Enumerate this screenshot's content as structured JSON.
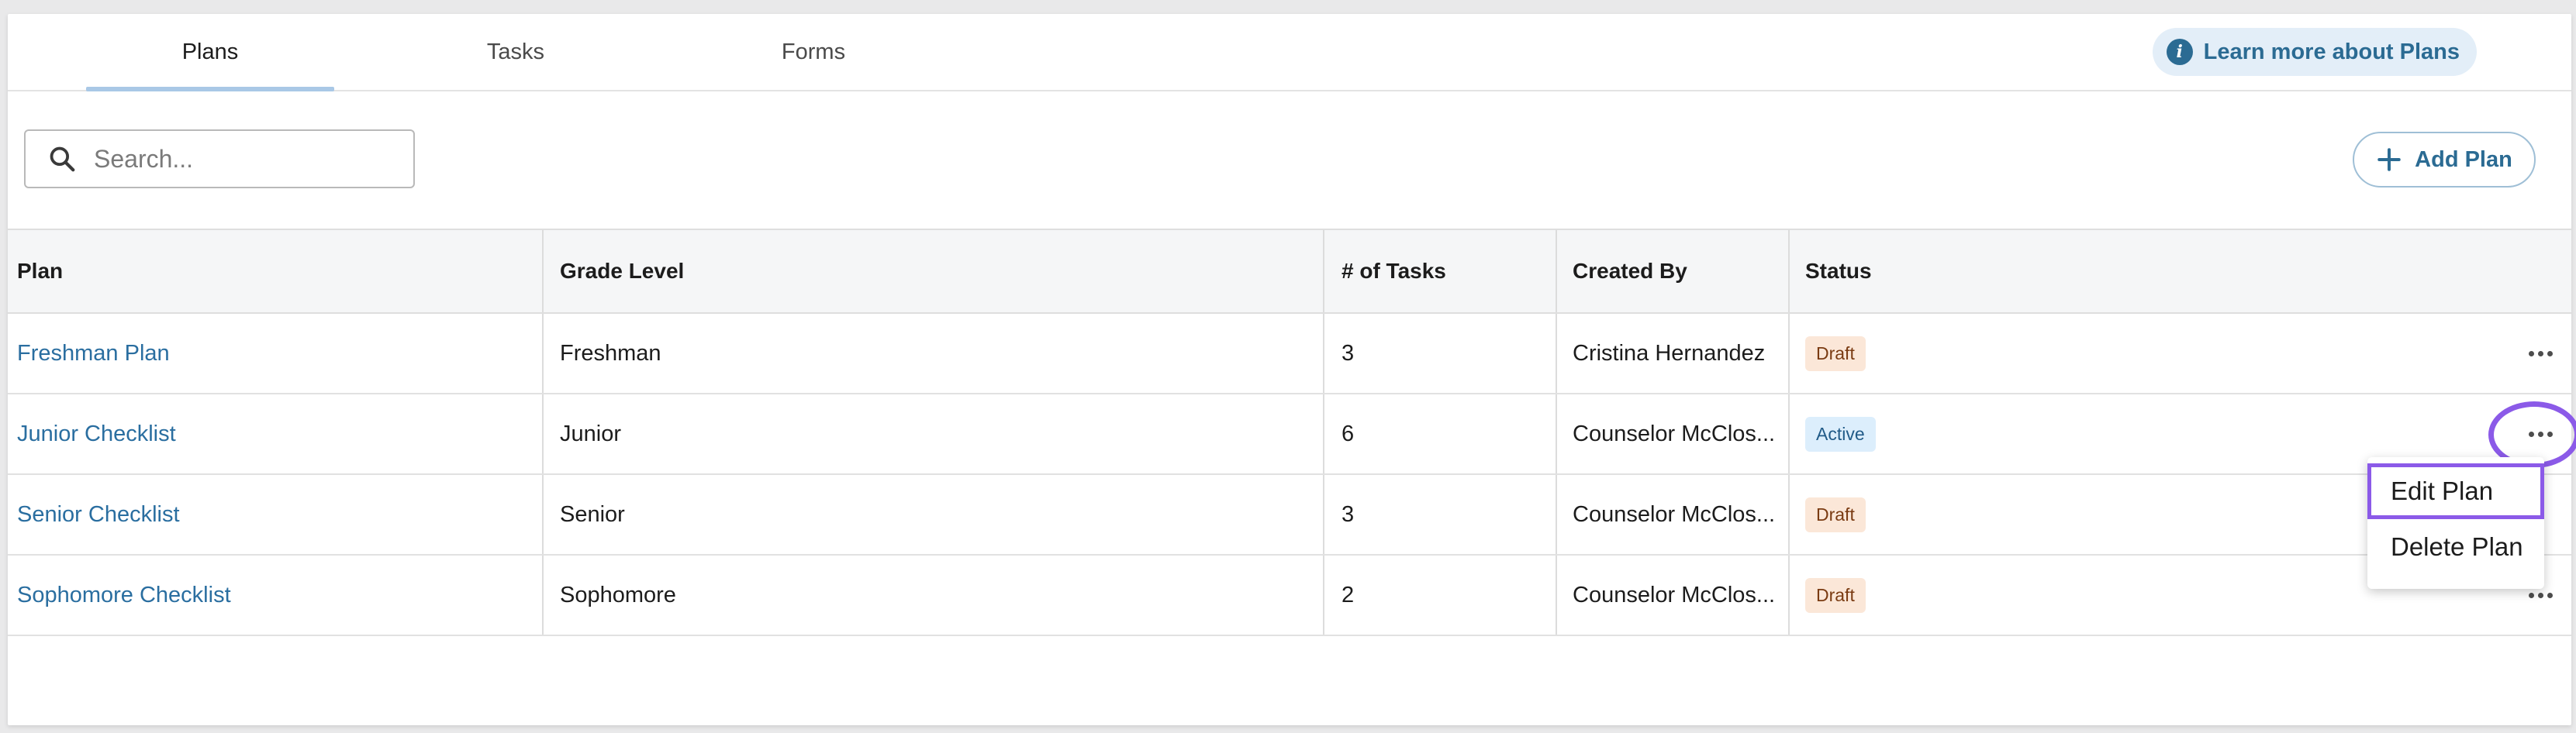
{
  "tabs": [
    {
      "label": "Plans",
      "active": true
    },
    {
      "label": "Tasks",
      "active": false
    },
    {
      "label": "Forms",
      "active": false
    }
  ],
  "learn_more": {
    "label": "Learn more about Plans",
    "icon": "info-icon"
  },
  "search": {
    "placeholder": "Search...",
    "value": "",
    "icon": "search-icon"
  },
  "add_button": {
    "label": "Add Plan",
    "icon": "plus-icon"
  },
  "table": {
    "headers": [
      "Plan",
      "Grade Level",
      "# of Tasks",
      "Created By",
      "Status"
    ],
    "rows": [
      {
        "plan": "Freshman Plan",
        "grade": "Freshman",
        "tasks": "3",
        "created_by": "Cristina Hernandez",
        "status": "Draft"
      },
      {
        "plan": "Junior Checklist",
        "grade": "Junior",
        "tasks": "6",
        "created_by": "Counselor McClos...",
        "status": "Active"
      },
      {
        "plan": "Senior Checklist",
        "grade": "Senior",
        "tasks": "3",
        "created_by": "Counselor McClos...",
        "status": "Draft"
      },
      {
        "plan": "Sophomore Checklist",
        "grade": "Sophomore",
        "tasks": "2",
        "created_by": "Counselor McClos...",
        "status": "Draft"
      }
    ]
  },
  "row_menu": {
    "items": [
      "Edit Plan",
      "Delete Plan"
    ]
  },
  "colors": {
    "accent": "#2b6b93",
    "link": "#2a6ea0",
    "highlight": "#8b5ae8",
    "draft_bg": "#fbe7d8",
    "active_bg": "#dceefc"
  }
}
